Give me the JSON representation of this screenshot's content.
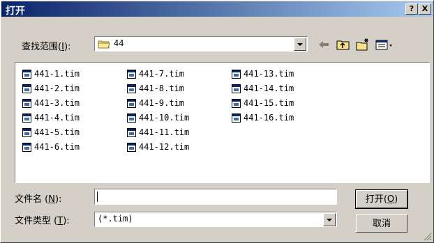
{
  "window": {
    "title": "打开",
    "help_label": "?",
    "close_label": "X"
  },
  "lookin": {
    "label_prefix": "查找范围",
    "label_key": "I",
    "label_suffix": "):",
    "label_open": "(",
    "value": "44"
  },
  "files": [
    "441-1.tim",
    "441-2.tim",
    "441-3.tim",
    "441-4.tim",
    "441-5.tim",
    "441-6.tim",
    "441-7.tim",
    "441-8.tim",
    "441-9.tim",
    "441-10.tim",
    "441-11.tim",
    "441-12.tim",
    "441-13.tim",
    "441-14.tim",
    "441-15.tim",
    "441-16.tim"
  ],
  "filename": {
    "label_prefix": "文件名",
    "label_open": "(",
    "label_key": "N",
    "label_suffix": "):",
    "value": ""
  },
  "filetype": {
    "label_prefix": "文件类型",
    "label_open": "(",
    "label_key": "T",
    "label_suffix": "):",
    "value": "(*.tim)"
  },
  "buttons": {
    "open_prefix": "打开",
    "open_open": "(",
    "open_key": "O",
    "open_close": ")",
    "cancel": "取消"
  },
  "colors": {
    "titlebar_start": "#0a246a",
    "titlebar_end": "#a6caf0",
    "face": "#d4d0c8"
  },
  "icons": [
    "folder-icon",
    "back-arrow-icon",
    "up-folder-icon",
    "new-folder-icon",
    "view-menu-icon",
    "file-icon"
  ]
}
